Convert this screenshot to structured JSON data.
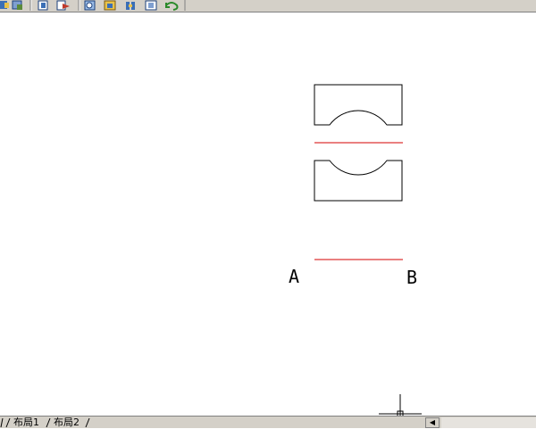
{
  "drawing": {
    "label_a": "A",
    "label_b": "B"
  },
  "layout_tabs": [
    "布局1",
    "布局2"
  ],
  "colors": {
    "line": "#000000",
    "red_line": "#d40000",
    "toolbar_bg": "#d4d0c8"
  },
  "icons": [
    "pan-icon",
    "print-icon",
    "layer-icon",
    "block-icon",
    "zoom-icon",
    "properties-icon",
    "design-center-icon",
    "tool-palette-icon",
    "undo-icon"
  ]
}
